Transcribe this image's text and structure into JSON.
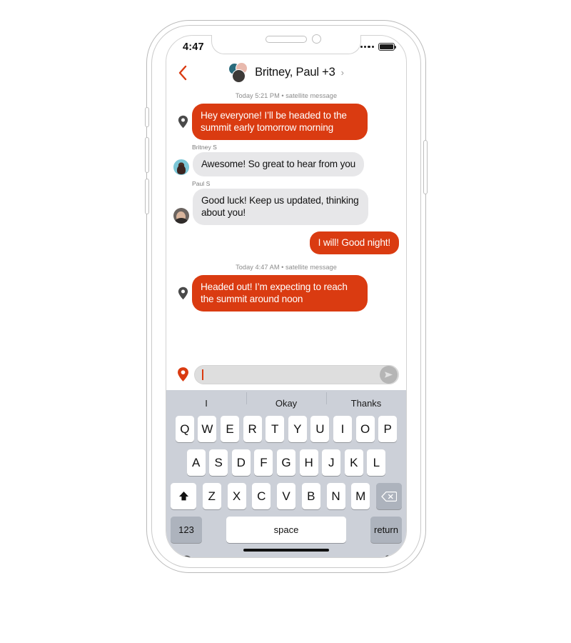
{
  "device": {
    "status_bar": {
      "time": "4:47",
      "location_icon": "location-arrow-icon",
      "signal_dots": 4,
      "battery_icon": "battery-full-icon"
    },
    "home_indicator": "home-indicator"
  },
  "header": {
    "back_icon": "chevron-left-icon",
    "title": "Britney, Paul +3",
    "chevron": "›",
    "avatars_label": "group-avatar-cluster"
  },
  "conversation": {
    "groups": [
      {
        "timestamp": "Today 5:21 PM • satellite message",
        "messages": [
          {
            "side": "outgoing",
            "satellite": true,
            "pin_icon": "map-pin-icon",
            "text": "Hey everyone! I’ll be headed to the summit early tomorrow morning"
          },
          {
            "side": "incoming",
            "sender": "Britney S",
            "avatar": "britney-avatar",
            "text": "Awesome! So great to hear from you"
          },
          {
            "side": "incoming",
            "sender": "Paul S",
            "avatar": "paul-avatar",
            "text": "Good luck! Keep us updated, thinking about you!"
          },
          {
            "side": "outgoing",
            "satellite": false,
            "text": "I will! Good night!"
          }
        ]
      },
      {
        "timestamp": "Today 4:47 AM • satellite message",
        "messages": [
          {
            "side": "outgoing",
            "satellite": true,
            "pin_icon": "map-pin-icon",
            "text": "Headed out! I’m expecting to reach the summit around noon"
          }
        ]
      }
    ]
  },
  "composer": {
    "pin_icon": "map-pin-icon",
    "input_value": "",
    "input_placeholder": "",
    "send_icon": "send-arrow-icon"
  },
  "keyboard": {
    "predictions": [
      "I",
      "Okay",
      "Thanks"
    ],
    "row1": [
      "Q",
      "W",
      "E",
      "R",
      "T",
      "Y",
      "U",
      "I",
      "O",
      "P"
    ],
    "row2": [
      "A",
      "S",
      "D",
      "F",
      "G",
      "H",
      "J",
      "K",
      "L"
    ],
    "row3": [
      "Z",
      "X",
      "C",
      "V",
      "B",
      "N",
      "M"
    ],
    "shift_icon": "shift-up-icon",
    "backspace_icon": "backspace-icon",
    "numbers_key": "123",
    "space_key": "space",
    "return_key": "return",
    "emoji_icon": "emoji-smiley-icon",
    "mic_icon": "microphone-icon"
  },
  "colors": {
    "accent_orange": "#da3b11",
    "bubble_gray": "#e7e7e9",
    "keyboard_bg": "#ccd0d8",
    "key_gray": "#adb3bd"
  }
}
